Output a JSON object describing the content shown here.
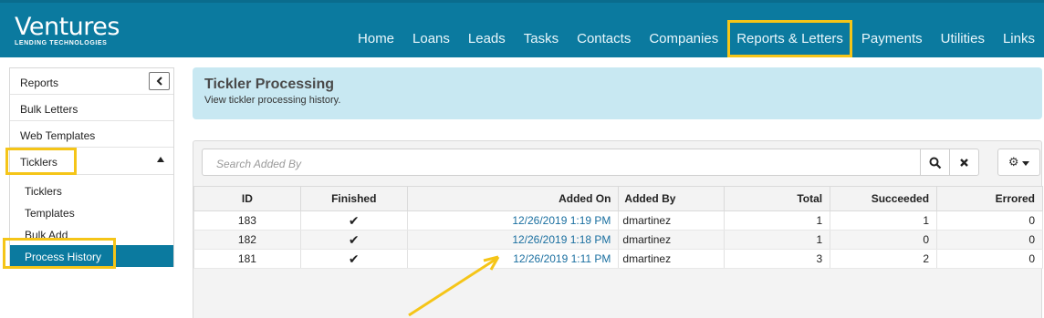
{
  "header": {
    "logo_main": "Ventures",
    "logo_sub": "LENDING TECHNOLOGIES",
    "nav": [
      {
        "label": "Home"
      },
      {
        "label": "Loans"
      },
      {
        "label": "Leads"
      },
      {
        "label": "Tasks"
      },
      {
        "label": "Contacts"
      },
      {
        "label": "Companies"
      },
      {
        "label": "Reports & Letters"
      },
      {
        "label": "Payments"
      },
      {
        "label": "Utilities"
      },
      {
        "label": "Links"
      }
    ]
  },
  "sidebar": {
    "items": [
      {
        "label": "Reports"
      },
      {
        "label": "Bulk Letters"
      },
      {
        "label": "Web Templates"
      },
      {
        "label": "Ticklers"
      }
    ],
    "collapse_icon": "chevron-left-icon",
    "sub_items": [
      {
        "label": "Ticklers"
      },
      {
        "label": "Templates"
      },
      {
        "label": "Bulk Add"
      },
      {
        "label": "Process History"
      }
    ]
  },
  "banner": {
    "title": "Tickler Processing",
    "subtitle": "View tickler processing history."
  },
  "search": {
    "placeholder": "Search Added By"
  },
  "table": {
    "columns": [
      "ID",
      "Finished",
      "Added On",
      "Added By",
      "Total",
      "Succeeded",
      "Errored"
    ],
    "rows": [
      {
        "id": "183",
        "finished": "✔",
        "added_on": "12/26/2019 1:19 PM",
        "added_by": "dmartinez",
        "total": "1",
        "succeeded": "1",
        "errored": "0"
      },
      {
        "id": "182",
        "finished": "✔",
        "added_on": "12/26/2019 1:18 PM",
        "added_by": "dmartinez",
        "total": "1",
        "succeeded": "0",
        "errored": "0"
      },
      {
        "id": "181",
        "finished": "✔",
        "added_on": "12/26/2019 1:11 PM",
        "added_by": "dmartinez",
        "total": "3",
        "succeeded": "2",
        "errored": "0"
      }
    ]
  },
  "colors": {
    "header_bg": "#0b7a9f",
    "highlight": "#f5c518",
    "banner_bg": "#c8e8f2",
    "link": "#1a6fa0"
  }
}
